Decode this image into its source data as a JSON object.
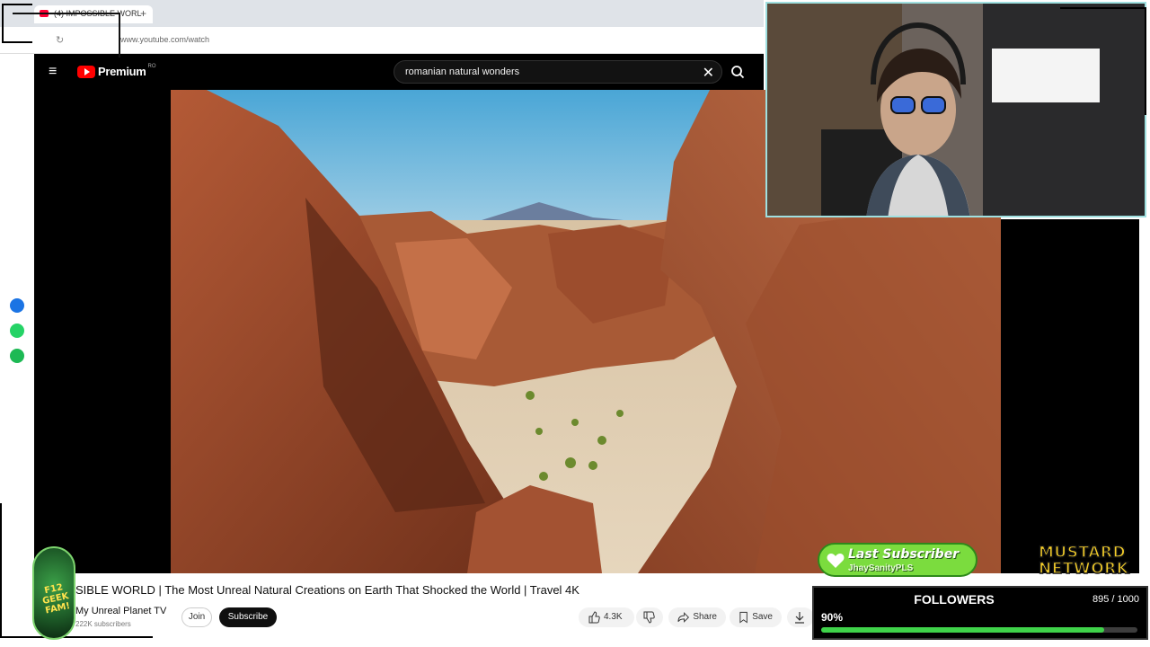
{
  "browser": {
    "tab_title": "(4) IMPOSSIBLE WORL",
    "new_tab": "+",
    "url": "www.youtube.com/watch"
  },
  "youtube": {
    "logo_text": "Premium",
    "logo_country": "RO",
    "search_value": "romanian natural wonders",
    "search_clear": "✕"
  },
  "video": {
    "title": "SIBLE WORLD | The Most Unreal Natural Creations on Earth That Shocked the World | Travel 4K",
    "channel": "My Unreal Planet TV",
    "subscribers": "222K subscribers",
    "join_label": "Join",
    "subscribe_label": "Subscribe",
    "likes": "4.3K",
    "share_label": "Share",
    "save_label": "Save"
  },
  "overlay": {
    "logo_text": "F12 GEEK FAM!",
    "last_subscriber_title": "Last Subscriber",
    "last_subscriber_name": "JhaySanityPLS",
    "network_line1": "MUSTARD",
    "network_line2": "NETWORK",
    "followers_label": "FOLLOWERS",
    "followers_count": "895 / 1000",
    "followers_percent": "90%",
    "followers_progress": 0.895
  },
  "colors": {
    "yt_red": "#ff0000",
    "progress_green": "#3fd24a",
    "mustard": "#f6cf2a"
  }
}
